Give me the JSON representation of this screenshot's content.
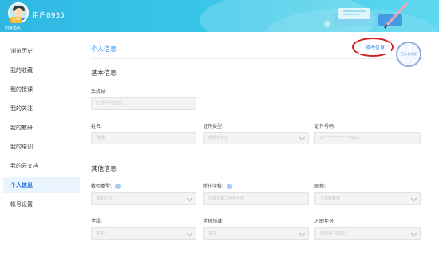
{
  "header": {
    "username": "用户8935",
    "avatar_badge": "老师",
    "switch_role": "切换角色",
    "colors": {
      "header_start": "#2fb7e3",
      "header_end": "#5fd8ee"
    }
  },
  "sidebar": {
    "items": [
      {
        "label": "浏览历史",
        "active": false
      },
      {
        "label": "我的收藏",
        "active": false
      },
      {
        "label": "我的授课",
        "active": false
      },
      {
        "label": "我的关注",
        "active": false
      },
      {
        "label": "我的教研",
        "active": false
      },
      {
        "label": "我的培训",
        "active": false
      },
      {
        "label": "我的云文档",
        "active": false
      },
      {
        "label": "个人信息",
        "active": true
      },
      {
        "label": "帐号设置",
        "active": false
      }
    ],
    "active_color": "#1f6fe0"
  },
  "main": {
    "title": "个人信息",
    "edit_label": "修改信息",
    "stamp_text": "已实名认证",
    "basic": {
      "heading": "基本信息",
      "phone": {
        "label": "手机号:",
        "value": "137****8935"
      },
      "name": {
        "label": "姓名:",
        "value": "易晴"
      },
      "id_type": {
        "label": "证件类型:",
        "value": "居民身份证"
      },
      "id_number": {
        "label": "证件号码:",
        "value": "11************0015"
      }
    },
    "other": {
      "heading": "其他信息",
      "teacher_type": {
        "label": "教师类型:",
        "value": "教职人员"
      },
      "school": {
        "label": "所在学校:",
        "value": "北京市第二中学分校"
      },
      "title_field": {
        "label": "职称:",
        "value": "正高级教师"
      },
      "stage": {
        "label": "学段:",
        "value": "初中"
      },
      "subject": {
        "label": "学科领域:",
        "value": "语文"
      },
      "entry_year": {
        "label": "入职年份:",
        "value": "请选择（选填）"
      }
    }
  }
}
